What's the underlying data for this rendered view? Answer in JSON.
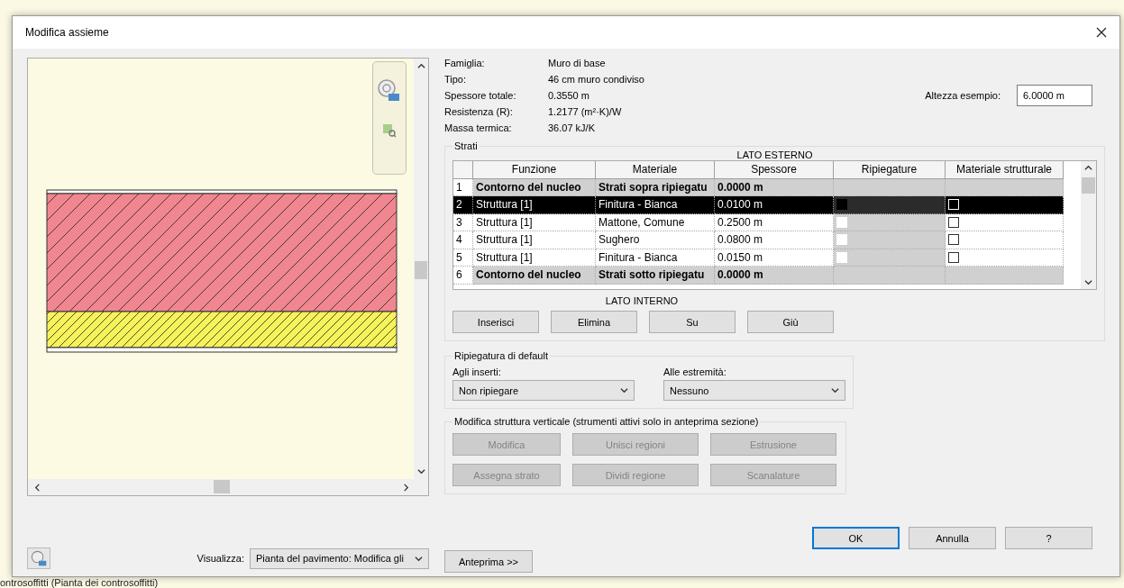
{
  "window": {
    "title": "Modifica assieme"
  },
  "background_text": "ontrosoffitti (Pianta dei controsoffitti)",
  "properties": [
    {
      "label": "Famiglia:",
      "value": "Muro di base"
    },
    {
      "label": "Tipo:",
      "value": "46 cm muro condiviso"
    },
    {
      "label": "Spessore totale:",
      "value": "0.3550 m"
    },
    {
      "label": "Resistenza (R):",
      "value": "1.2177 (m²·K)/W"
    },
    {
      "label": "Massa termica:",
      "value": "36.07 kJ/K"
    }
  ],
  "sample_height": {
    "label": "Altezza esempio:",
    "value": "6.0000 m"
  },
  "layers": {
    "title": "Strati",
    "top_label": "LATO ESTERNO",
    "bottom_label": "LATO INTERNO",
    "columns": [
      "Funzione",
      "Materiale",
      "Spessore",
      "Ripiegature",
      "Materiale strutturale"
    ],
    "rows": [
      {
        "kind": "core",
        "number": "1",
        "function": "Contorno del nucleo",
        "material": "Strati sopra ripiegatu",
        "thickness": "0.0000 m",
        "selected": false
      },
      {
        "kind": "layer",
        "number": "2",
        "function": "Struttura [1]",
        "material": "Finitura - Bianca",
        "thickness": "0.0100 m",
        "wraps": false,
        "structural": false,
        "selected": true
      },
      {
        "kind": "layer",
        "number": "3",
        "function": "Struttura [1]",
        "material": "Mattone, Comune",
        "thickness": "0.2500 m",
        "wraps": false,
        "structural": false,
        "selected": false
      },
      {
        "kind": "layer",
        "number": "4",
        "function": "Struttura [1]",
        "material": "Sughero",
        "thickness": "0.0800 m",
        "wraps": false,
        "structural": false,
        "selected": false
      },
      {
        "kind": "layer",
        "number": "5",
        "function": "Struttura [1]",
        "material": "Finitura - Bianca",
        "thickness": "0.0150 m",
        "wraps": false,
        "structural": false,
        "selected": false
      },
      {
        "kind": "core",
        "number": "6",
        "function": "Contorno del nucleo",
        "material": "Strati sotto ripiegatu",
        "thickness": "0.0000 m",
        "selected": false
      }
    ],
    "buttons": [
      "Inserisci",
      "Elimina",
      "Su",
      "Giù"
    ]
  },
  "default_wrapping": {
    "title": "Ripiegatura di default",
    "fields": [
      {
        "label": "Agli inserti:",
        "value": "Non ripiegare"
      },
      {
        "label": "Alle estremità:",
        "value": "Nessuno"
      }
    ]
  },
  "vertical_structure": {
    "title": "Modifica struttura verticale (strumenti attivi solo in anteprima sezione)",
    "buttons": [
      {
        "label": "Modifica",
        "disabled": true
      },
      {
        "label": "Unisci regioni",
        "disabled": true
      },
      {
        "label": "Estrusione",
        "disabled": true
      },
      {
        "label": "Assegna strato",
        "disabled": true
      },
      {
        "label": "Dividi regione",
        "disabled": true
      },
      {
        "label": "Scanalature",
        "disabled": true
      }
    ]
  },
  "view": {
    "label": "Visualizza:",
    "value": "Pianta del pavimento: Modifica gli"
  },
  "preview_button": "Anteprima >>",
  "dialog_buttons": [
    {
      "label": "OK",
      "default": true
    },
    {
      "label": "Annulla",
      "default": false
    },
    {
      "label": "?",
      "default": false
    }
  ]
}
